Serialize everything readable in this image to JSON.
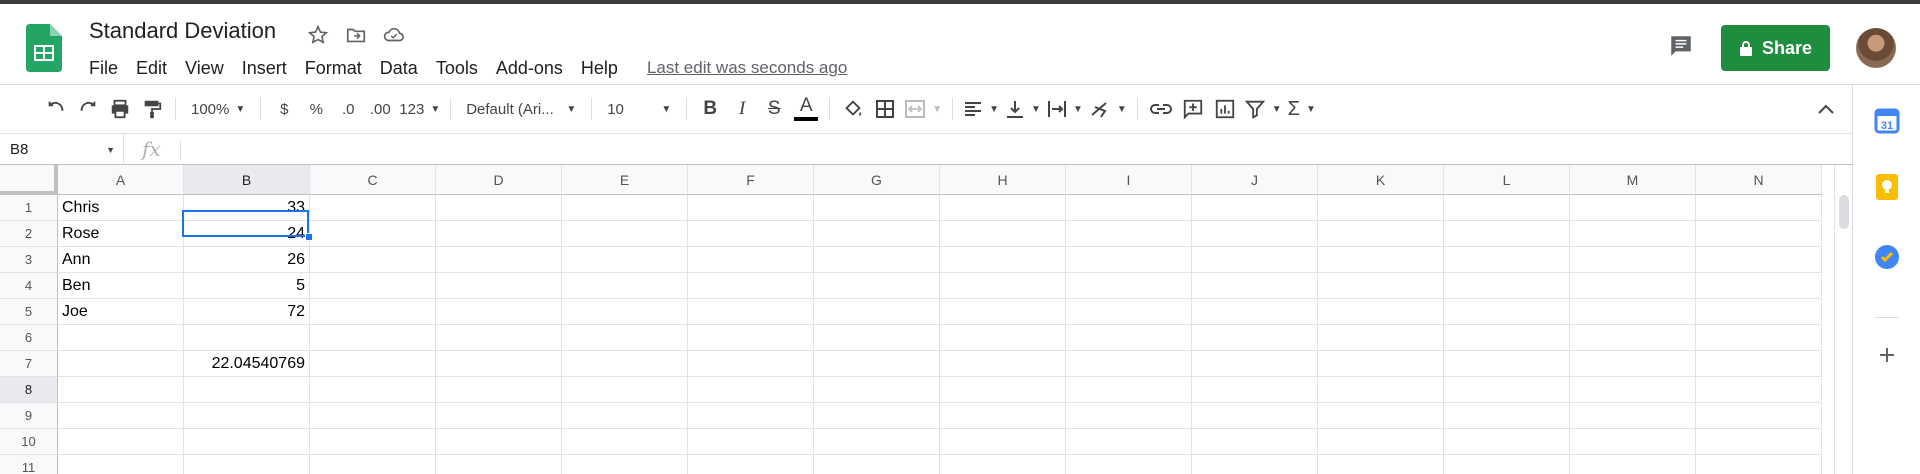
{
  "app": {
    "title": "Standard Deviation",
    "last_edit": "Last edit was seconds ago",
    "share_label": "Share",
    "accent_color": "#1e8e3e"
  },
  "menu": [
    "File",
    "Edit",
    "View",
    "Insert",
    "Format",
    "Data",
    "Tools",
    "Add-ons",
    "Help"
  ],
  "toolbar": {
    "zoom": "100%",
    "currency": "$",
    "percent": "%",
    "dec_decrease": ".0",
    "dec_increase": ".00",
    "more_formats": "123",
    "font": "Default (Ari...",
    "font_size": "10",
    "bold": "B",
    "italic": "I",
    "strike": "S",
    "text_color": "A",
    "functions": "Σ"
  },
  "formula_bar": {
    "name_box": "B8",
    "fx": "fx",
    "formula": ""
  },
  "sheet": {
    "columns": [
      "A",
      "B",
      "C",
      "D",
      "E",
      "F",
      "G",
      "H",
      "I",
      "J",
      "K",
      "L",
      "M",
      "N"
    ],
    "rows": [
      "1",
      "2",
      "3",
      "4",
      "5",
      "6",
      "7",
      "8",
      "9",
      "10",
      "11"
    ],
    "selected_cell": "B8",
    "cells": {
      "A1": "Chris",
      "B1": "33",
      "A2": "Rose",
      "B2": "24",
      "A3": "Ann",
      "B3": "26",
      "A4": "Ben",
      "B4": "5",
      "A5": "Joe",
      "B5": "72",
      "B7": "22.04540769"
    }
  },
  "side_panel": [
    "calendar-icon",
    "keep-icon",
    "tasks-icon",
    "add-icon"
  ]
}
